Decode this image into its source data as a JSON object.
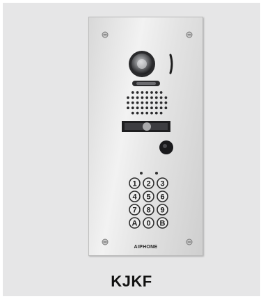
{
  "product": {
    "model_label": "KJKF",
    "brand_label": "AIPHONE"
  },
  "keypad": {
    "keys": [
      "1",
      "2",
      "3",
      "4",
      "5",
      "6",
      "7",
      "8",
      "9",
      "A",
      "0",
      "B"
    ]
  },
  "icons": {
    "camera": "camera-lens-icon",
    "speaker": "speaker-grille-icon",
    "sensor": "proximity-sensor-icon",
    "screw": "screw-icon"
  },
  "colors": {
    "background": "#e6e6e7",
    "panel": "#e4e4e4",
    "label": "#111111"
  }
}
